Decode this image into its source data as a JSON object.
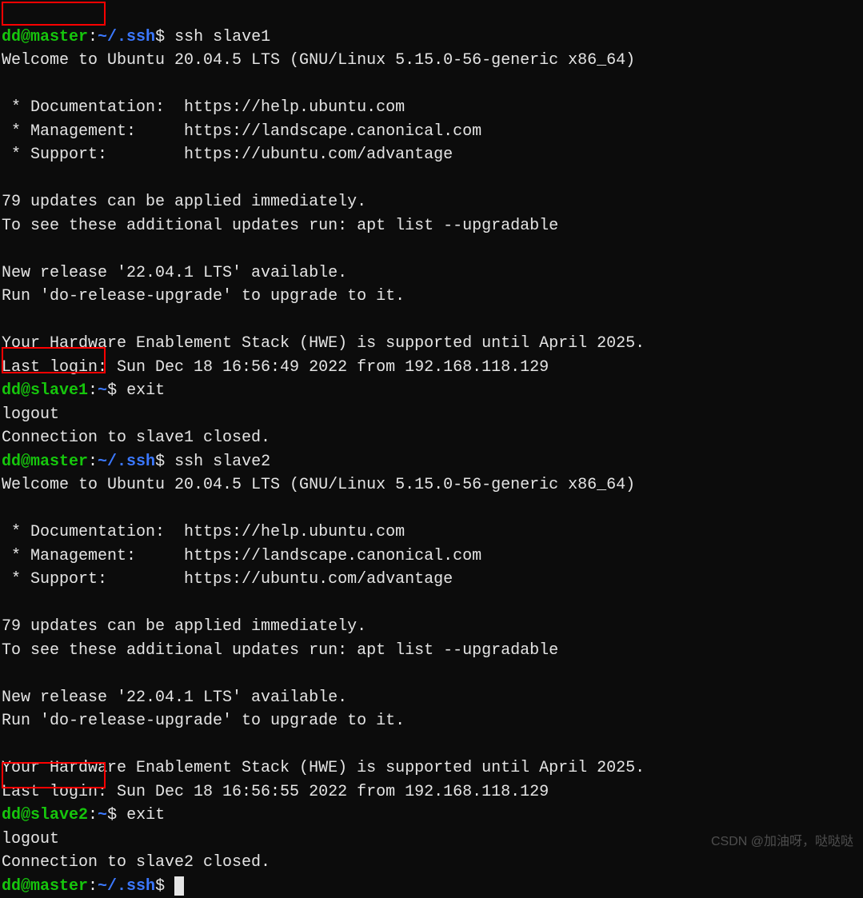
{
  "prompt1_user": "dd@master",
  "prompt1_path": "~/.ssh",
  "cmd1": "ssh slave1",
  "welcome": "Welcome to Ubuntu 20.04.5 LTS (GNU/Linux 5.15.0-56-generic x86_64)",
  "doc_line": " * Documentation:  https://help.ubuntu.com",
  "mgmt_line": " * Management:     https://landscape.canonical.com",
  "sup_line": " * Support:        https://ubuntu.com/advantage",
  "updates1": "79 updates can be applied immediately.",
  "updates2": "To see these additional updates run: apt list --upgradable",
  "release1": "New release '22.04.1 LTS' available.",
  "release2": "Run 'do-release-upgrade' to upgrade to it.",
  "hwe": "Your Hardware Enablement Stack (HWE) is supported until April 2025.",
  "lastlogin1": "Last login: Sun Dec 18 16:56:49 2022 from 192.168.118.129",
  "prompt2_user": "dd@slave1",
  "prompt2_path": "~",
  "cmd2": "exit",
  "logout": "logout",
  "closed1": "Connection to slave1 closed.",
  "prompt3_user": "dd@master",
  "prompt3_path": "~/.ssh",
  "cmd3": "ssh slave2",
  "lastlogin2": "Last login: Sun Dec 18 16:56:55 2022 from 192.168.118.129",
  "prompt4_user": "dd@slave2",
  "prompt4_path": "~",
  "cmd4": "exit",
  "closed2": "Connection to slave2 closed.",
  "prompt5_user": "dd@master",
  "prompt5_path": "~/.ssh",
  "watermark": "CSDN @加油呀，哒哒哒"
}
